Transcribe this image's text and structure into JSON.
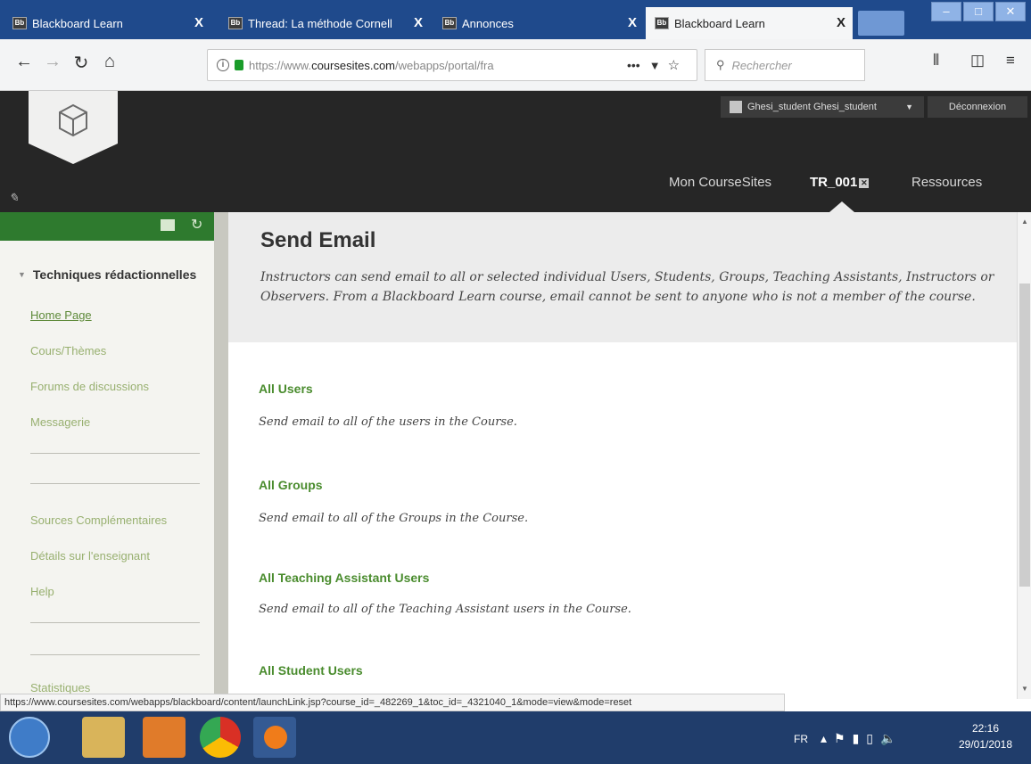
{
  "browser": {
    "tabs": [
      {
        "favicon": "Bb",
        "title": "Blackboard Learn",
        "close": "X"
      },
      {
        "favicon": "Bb",
        "title": "Thread: La méthode Cornell",
        "close": "X"
      },
      {
        "favicon": "Bb",
        "title": "Annonces",
        "close": "X"
      },
      {
        "favicon": "Bb",
        "title": "Blackboard Learn",
        "close": "X"
      }
    ],
    "url_prefix": "https://www.",
    "url_domain": "coursesites.com",
    "url_path": "/webapps/portal/fra",
    "search_placeholder": "Rechercher",
    "overflow_label": "•••"
  },
  "header": {
    "user_name": "Ghesi_student Ghesi_student",
    "logout_label": "Déconnexion",
    "nav": {
      "my_coursesites": "Mon CourseSites",
      "course_id": "TR_001",
      "resources": "Ressources"
    }
  },
  "sidebar": {
    "course_title": "Techniques rédactionnelles",
    "items_top": [
      "Home Page",
      "Cours/Thèmes",
      "Forums de discussions",
      "Messagerie"
    ],
    "items_bottom": [
      "Sources Complémentaires",
      "Détails sur l'enseignant",
      "Help"
    ],
    "item_cut": "Statistiques"
  },
  "main": {
    "title": "Send Email",
    "description": "Instructors can send email to all or selected individual Users, Students, Groups, Teaching Assistants, Instructors or Observers. From a Blackboard Learn course, email cannot be sent to anyone who is not a member of the course.",
    "options": [
      {
        "title": "All Users",
        "desc": "Send email to all of the users in the Course."
      },
      {
        "title": "All Groups",
        "desc": "Send email to all of the Groups in the Course."
      },
      {
        "title": "All Teaching Assistant Users",
        "desc": "Send email to all of the Teaching Assistant users in the Course."
      },
      {
        "title": "All Student Users",
        "desc": ""
      }
    ]
  },
  "status_url": "https://www.coursesites.com/webapps/blackboard/content/launchLink.jsp?course_id=_482269_1&toc_id=_4321040_1&mode=view&mode=reset",
  "taskbar": {
    "lang": "FR",
    "time": "22:16",
    "date": "29/01/2018"
  },
  "colors": {
    "tab_strip": "#1f4a8c",
    "bb_header": "#262626",
    "course_menu_green": "#2e7a2e",
    "link_green": "#4a8c2e",
    "taskbar": "#203d6b"
  },
  "icons": [
    "back-arrow-icon",
    "forward-arrow-icon",
    "reload-icon",
    "home-icon",
    "info-icon",
    "lock-icon",
    "pocket-icon",
    "star-icon",
    "search-icon",
    "library-icon",
    "sidebar-icon",
    "menu-icon"
  ]
}
